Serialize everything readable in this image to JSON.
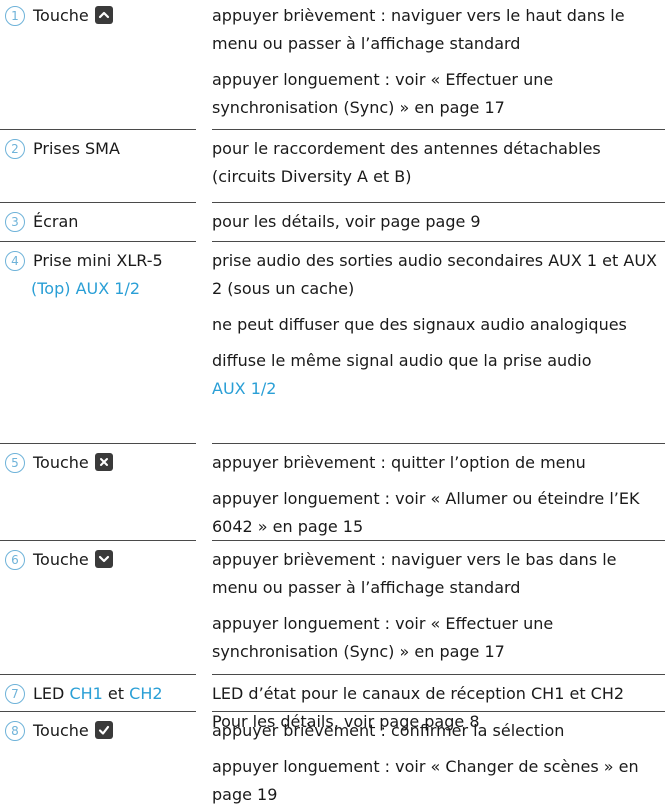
{
  "rows": [
    {
      "number": "1",
      "label": "Touche",
      "key_icon": "chevron-up-icon",
      "descriptions": [
        "appuyer brièvement : naviguer vers le haut dans le menu ou passer à l’affichage standard",
        "appuyer longuement : voir « Effectuer une synchronisation (Sync) » en page 17"
      ]
    },
    {
      "number": "2",
      "label": "Prises SMA",
      "descriptions": [
        "pour le raccordement des antennes détachables (circuits Diversity A et B)"
      ]
    },
    {
      "number": "3",
      "label": "Écran",
      "descriptions": [
        "pour les détails, voir page page 9"
      ]
    },
    {
      "number": "4",
      "label": "Prise mini XLR-5",
      "label_line2": "(Top) AUX 1/2",
      "descriptions": [
        "prise audio des sorties audio secondaires AUX 1 et AUX 2 (sous un cache)",
        "ne peut diffuser que des signaux audio analogiques",
        "diffuse le même signal audio que la prise audio"
      ],
      "desc_link": "AUX 1/2"
    },
    {
      "number": "5",
      "label": "Touche",
      "key_icon": "close-icon",
      "descriptions": [
        "appuyer brièvement : quitter l’option de menu",
        "appuyer longuement : voir « Allumer ou éteindre l’EK 6042 » en page 15"
      ]
    },
    {
      "number": "6",
      "label": "Touche",
      "key_icon": "chevron-down-icon",
      "descriptions": [
        "appuyer brièvement : naviguer vers le bas dans le menu ou passer à l’affichage standard",
        "appuyer longuement : voir « Effectuer une synchronisation (Sync) » en page 17"
      ]
    },
    {
      "number": "7",
      "label_parts": [
        "LED",
        "CH1",
        "et",
        "CH2"
      ],
      "descriptions": [
        "LED d’état pour le canaux de réception CH1 et CH2",
        "Pour les détails, voir page page 8"
      ]
    },
    {
      "number": "8",
      "label": "Touche",
      "key_icon": "check-icon",
      "descriptions": [
        "appuyer brièvement : confirmer la sélection",
        "appuyer longuement : voir « Changer de scènes » en page 19"
      ]
    }
  ]
}
